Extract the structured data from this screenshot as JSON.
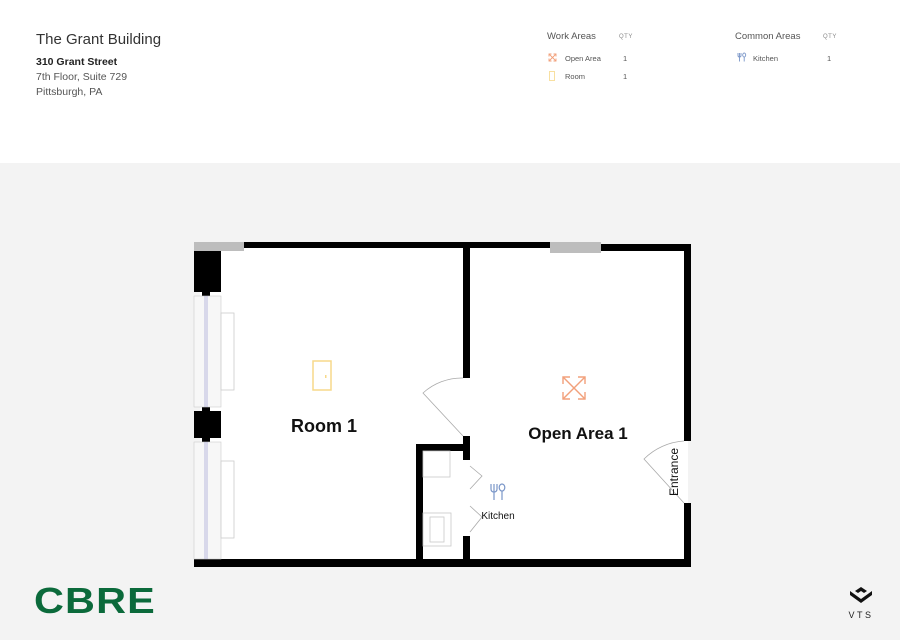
{
  "header": {
    "building_name": "The Grant Building",
    "address_line1": "310 Grant Street",
    "address_line2": "7th Floor, Suite 729",
    "address_line3": "Pittsburgh, PA"
  },
  "legend": {
    "work_areas": {
      "title": "Work Areas",
      "qty_label": "QTY",
      "items": [
        {
          "label": "Open Area",
          "qty": "1",
          "icon": "expand-arrows-icon",
          "color": "#f2a07b"
        },
        {
          "label": "Room",
          "qty": "1",
          "icon": "door-icon",
          "color": "#f7d98a"
        }
      ]
    },
    "common_areas": {
      "title": "Common Areas",
      "qty_label": "QTY",
      "items": [
        {
          "label": "Kitchen",
          "qty": "1",
          "icon": "fork-spoon-icon",
          "color": "#7a96c8"
        }
      ]
    }
  },
  "floorplan": {
    "rooms": [
      {
        "label": "Room 1",
        "type": "Room"
      },
      {
        "label": "Open Area 1",
        "type": "Open Area"
      },
      {
        "label": "Kitchen",
        "type": "Kitchen"
      }
    ],
    "entrance_label": "Entrance"
  },
  "branding": {
    "left_logo": "CBRE",
    "left_logo_color": "#0b6a3b",
    "right_logo": "VTS"
  }
}
